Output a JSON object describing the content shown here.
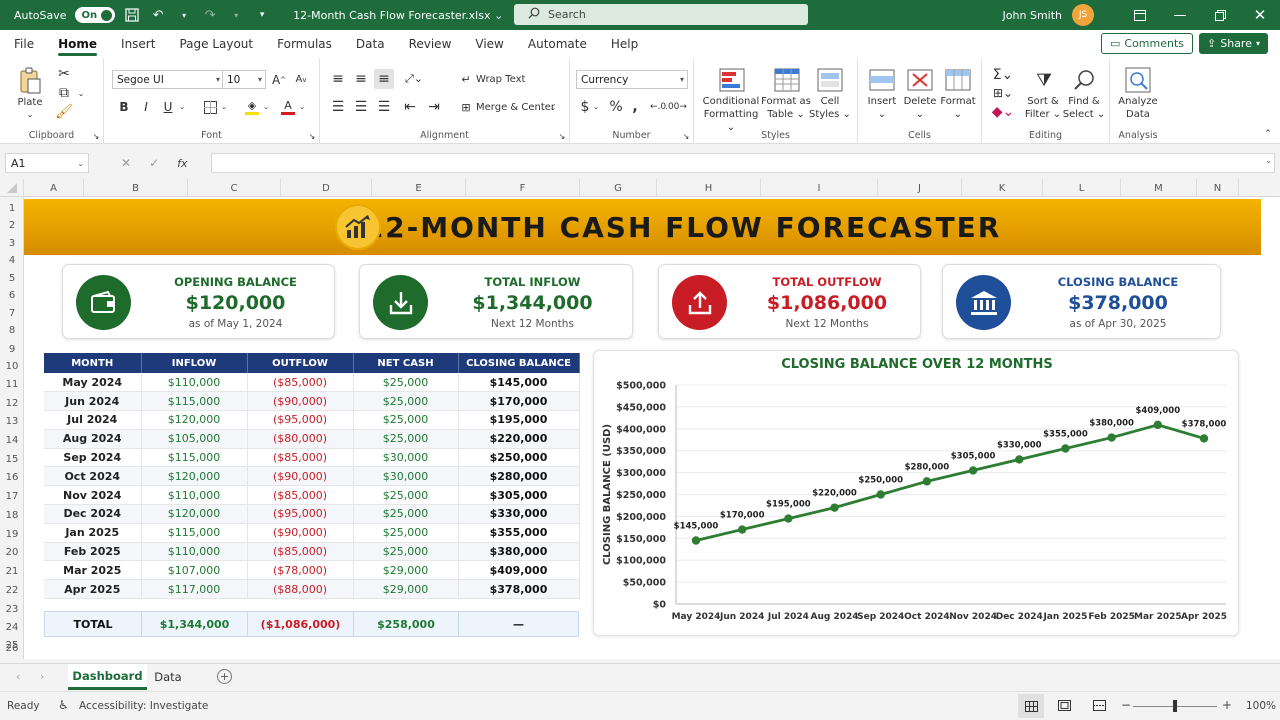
{
  "titlebar": {
    "autosave_label": "AutoSave",
    "autosave_state": "On",
    "file_name": "12-Month Cash Flow Forecaster.xlsx",
    "search_placeholder": "Search",
    "user_name": "John Smith",
    "user_initials": "JS"
  },
  "menu": {
    "items": [
      "File",
      "Home",
      "Insert",
      "Page Layout",
      "Formulas",
      "Data",
      "Review",
      "View",
      "Automate",
      "Help"
    ],
    "active": "Home",
    "comments_label": "Comments",
    "share_label": "Share"
  },
  "ribbon": {
    "clipboard": {
      "paste": "Plate",
      "label": "Clipboard"
    },
    "font": {
      "name": "Segoe UI",
      "size": "10",
      "label": "Font"
    },
    "alignment": {
      "wrap": "Wrap Text",
      "merge": "Merge & Center",
      "label": "Alignment"
    },
    "number": {
      "format": "Currency",
      "label": "Number"
    },
    "styles": {
      "cond1": "Conditional",
      "cond2": "Formatting",
      "fmt1": "Format as",
      "fmt2": "Table",
      "cell1": "Cell",
      "cell2": "Styles",
      "label": "Styles"
    },
    "cells": {
      "insert": "Insert",
      "delete": "Delete",
      "format": "Format",
      "label": "Cells"
    },
    "editing": {
      "sort1": "Sort &",
      "sort2": "Filter",
      "find1": "Find &",
      "find2": "Select",
      "label": "Editing"
    },
    "analysis": {
      "a1": "Analyze",
      "a2": "Data",
      "label": "Analysis"
    }
  },
  "formula_bar": {
    "cell_ref": "A1",
    "formula": ""
  },
  "columns": [
    "A",
    "B",
    "C",
    "D",
    "E",
    "F",
    "G",
    "H",
    "I",
    "J",
    "K",
    "L",
    "M",
    "N"
  ],
  "rows": [
    "1",
    "2",
    "3",
    "4",
    "5",
    "6",
    "7",
    "8",
    "9",
    "10",
    "11",
    "12",
    "13",
    "14",
    "15",
    "16",
    "17",
    "18",
    "19",
    "20",
    "21",
    "22",
    "23",
    "24",
    "25",
    "26"
  ],
  "banner": {
    "title": "12-MONTH CASH FLOW FORECASTER"
  },
  "cards": [
    {
      "label": "OPENING BALANCE",
      "value": "$120,000",
      "sub": "as of May 1, 2024",
      "color": "#1e6b2c",
      "icon": "wallet-icon"
    },
    {
      "label": "TOTAL INFLOW",
      "value": "$1,344,000",
      "sub": "Next 12 Months",
      "color": "#1e6b2c",
      "icon": "download-icon"
    },
    {
      "label": "TOTAL OUTFLOW",
      "value": "$1,086,000",
      "sub": "Next 12 Months",
      "color": "#c81d25",
      "icon": "upload-icon"
    },
    {
      "label": "CLOSING BALANCE",
      "value": "$378,000",
      "sub": "as of Apr 30, 2025",
      "color": "#1f4f99",
      "icon": "bank-icon"
    }
  ],
  "table": {
    "headers": [
      "MONTH",
      "INFLOW",
      "OUTFLOW",
      "NET CASH",
      "CLOSING BALANCE"
    ],
    "rows": [
      [
        "May 2024",
        "$110,000",
        "($85,000)",
        "$25,000",
        "$145,000"
      ],
      [
        "Jun 2024",
        "$115,000",
        "($90,000)",
        "$25,000",
        "$170,000"
      ],
      [
        "Jul 2024",
        "$120,000",
        "($95,000)",
        "$25,000",
        "$195,000"
      ],
      [
        "Aug 2024",
        "$105,000",
        "($80,000)",
        "$25,000",
        "$220,000"
      ],
      [
        "Sep 2024",
        "$115,000",
        "($85,000)",
        "$30,000",
        "$250,000"
      ],
      [
        "Oct 2024",
        "$120,000",
        "($90,000)",
        "$30,000",
        "$280,000"
      ],
      [
        "Nov 2024",
        "$110,000",
        "($85,000)",
        "$25,000",
        "$305,000"
      ],
      [
        "Dec 2024",
        "$120,000",
        "($95,000)",
        "$25,000",
        "$330,000"
      ],
      [
        "Jan 2025",
        "$115,000",
        "($90,000)",
        "$25,000",
        "$355,000"
      ],
      [
        "Feb 2025",
        "$110,000",
        "($85,000)",
        "$25,000",
        "$380,000"
      ],
      [
        "Mar 2025",
        "$107,000",
        "($78,000)",
        "$29,000",
        "$409,000"
      ],
      [
        "Apr 2025",
        "$117,000",
        "($88,000)",
        "$29,000",
        "$378,000"
      ]
    ],
    "total": [
      "TOTAL",
      "$1,344,000",
      "($1,086,000)",
      "$258,000",
      "—"
    ]
  },
  "chart_data": {
    "type": "line",
    "title": "CLOSING BALANCE OVER 12 MONTHS",
    "xlabel": "",
    "ylabel": "CLOSING BALANCE (USD)",
    "categories": [
      "May 2024",
      "Jun 2024",
      "Jul 2024",
      "Aug 2024",
      "Sep 2024",
      "Oct 2024",
      "Nov 2024",
      "Dec 2024",
      "Jan 2025",
      "Feb 2025",
      "Mar 2025",
      "Apr 2025"
    ],
    "values": [
      145000,
      170000,
      195000,
      220000,
      250000,
      280000,
      305000,
      330000,
      355000,
      380000,
      409000,
      378000
    ],
    "data_labels": [
      "$145,000",
      "$170,000",
      "$195,000",
      "$220,000",
      "$250,000",
      "$280,000",
      "$305,000",
      "$330,000",
      "$355,000",
      "$380,000",
      "$409,000",
      "$378,000"
    ],
    "ylim": [
      0,
      500000
    ],
    "yticks": [
      "$0",
      "$50,000",
      "$100,000",
      "$150,000",
      "$200,000",
      "$250,000",
      "$300,000",
      "$350,000",
      "$400,000",
      "$450,000",
      "$500,000"
    ],
    "grid": true,
    "color": "#2e7d32"
  },
  "sheet_tabs": {
    "tabs": [
      "Dashboard",
      "Data"
    ],
    "active": "Dashboard"
  },
  "status": {
    "ready": "Ready",
    "accessibility": "Accessibility: Investigate",
    "zoom": "100%"
  }
}
